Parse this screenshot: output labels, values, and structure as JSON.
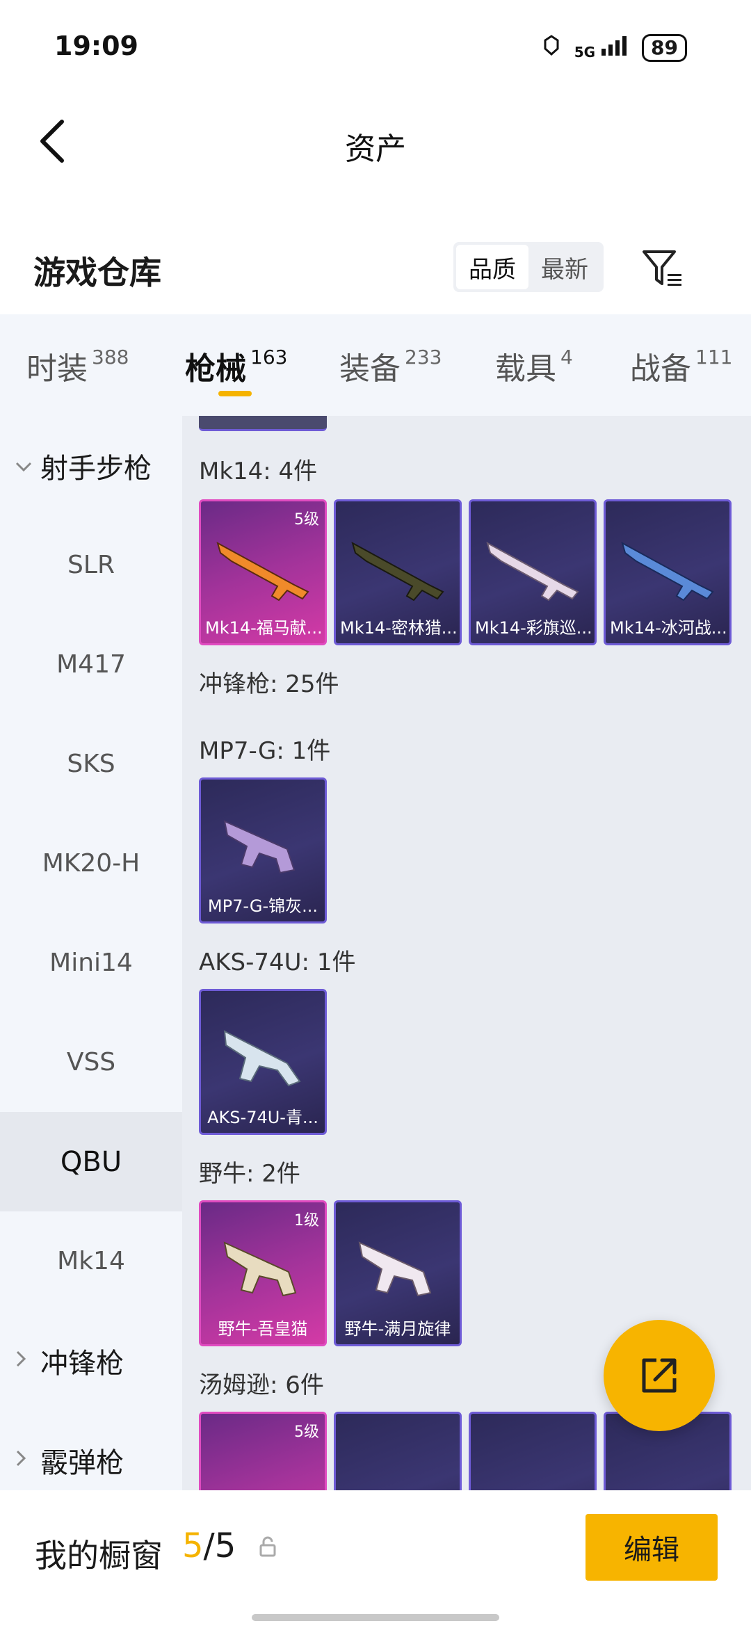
{
  "status_bar": {
    "time": "19:09",
    "network": "5G",
    "battery": "89"
  },
  "header": {
    "title": "资产"
  },
  "warehouse": {
    "title": "游戏仓库",
    "sort_options": [
      "品质",
      "最新"
    ]
  },
  "tabs": [
    {
      "label": "时装",
      "count": "388"
    },
    {
      "label": "枪械",
      "count": "163"
    },
    {
      "label": "装备",
      "count": "233"
    },
    {
      "label": "载具",
      "count": "4"
    },
    {
      "label": "战备",
      "count": "111"
    }
  ],
  "sidebar": {
    "group_marksman": "射手步枪",
    "items": [
      "SLR",
      "M417",
      "SKS",
      "MK20-H",
      "Mini14",
      "VSS",
      "QBU",
      "Mk14"
    ],
    "group_smg": "冲锋枪",
    "group_shotgun": "霰弹枪"
  },
  "content": {
    "mk14_header": "Mk14: 4件",
    "mk14_cards": [
      "Mk14-福马献...",
      "Mk14-密林猎...",
      "Mk14-彩旗巡...",
      "Mk14-冰河战..."
    ],
    "mk14_level": "5级",
    "smg_header": "冲锋枪: 25件",
    "mp7_header": "MP7-G: 1件",
    "mp7_card": "MP7-G-锦灰...",
    "aks_header": "AKS-74U: 1件",
    "aks_card": "AKS-74U-青...",
    "bison_header": "野牛: 2件",
    "bison_cards": [
      "野牛-吾皇猫",
      "野牛-满月旋律"
    ],
    "bison_level": "1级",
    "thompson_header": "汤姆逊: 6件",
    "thompson_level": "5级"
  },
  "bottom_bar": {
    "showcase_label": "我的橱窗",
    "showcase_current": "5",
    "showcase_total": "/5",
    "edit_label": "编辑"
  }
}
